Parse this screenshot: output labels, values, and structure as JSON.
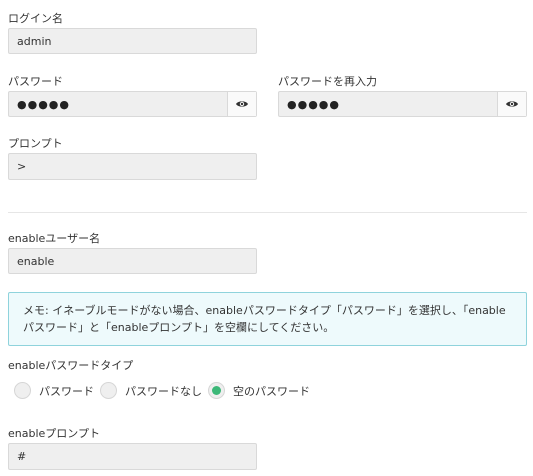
{
  "login": {
    "label": "ログイン名",
    "value": "admin"
  },
  "password": {
    "label": "パスワード",
    "value": "●●●●●",
    "eye_icon": "eye-icon"
  },
  "password_confirm": {
    "label": "パスワードを再入力",
    "value": "●●●●●",
    "eye_icon": "eye-icon"
  },
  "prompt": {
    "label": "プロンプト",
    "value": ">"
  },
  "enable_user": {
    "label": "enableユーザー名",
    "value": "enable"
  },
  "note": {
    "line1": "メモ: イネーブルモードがない場合、enableパスワードタイプ「パスワード」を選択し、「enable",
    "line2": "パスワード」と「enableプロンプト」を空欄にしてください。"
  },
  "enable_password_type": {
    "label": "enableパスワードタイプ",
    "options": [
      {
        "label": "パスワード",
        "selected": false
      },
      {
        "label": "パスワードなし",
        "selected": false
      },
      {
        "label": "空のパスワード",
        "selected": true
      }
    ],
    "selected_color": "#3cb878"
  },
  "enable_prompt": {
    "label": "enableプロンプト",
    "value": "#"
  }
}
